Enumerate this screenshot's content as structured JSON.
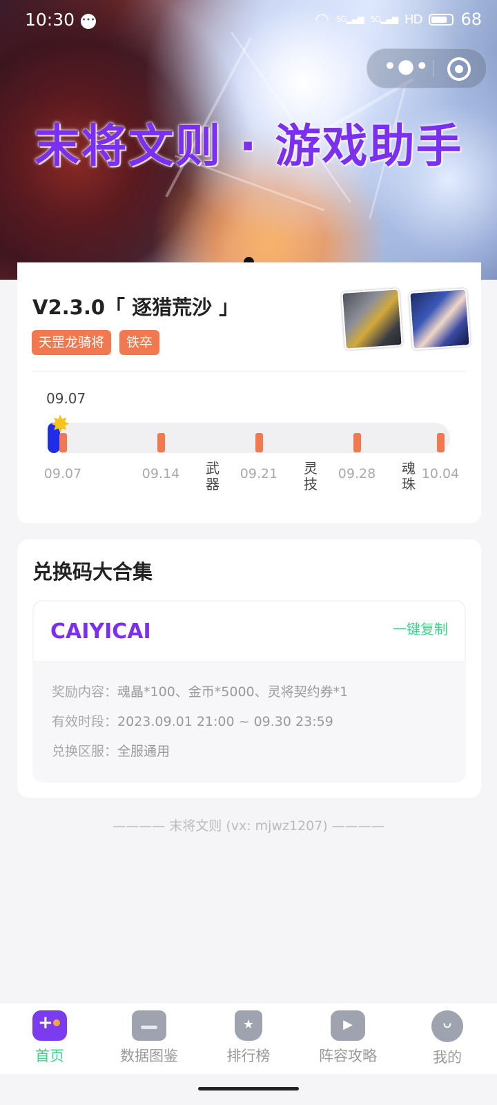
{
  "status_bar": {
    "time": "10:30",
    "signal1": "5G",
    "signal2": "5G",
    "hd": "HD",
    "battery": "68"
  },
  "banner": {
    "title": "末将文则 · 游戏助手"
  },
  "version": {
    "title": "V2.3.0「 逐猎荒沙 」",
    "tags": [
      "天罡龙骑将",
      "铁卒"
    ],
    "current_date": "09.07",
    "progress": 0.0,
    "timeline_labels": [
      "09.07",
      "09.14",
      "09.21",
      "09.28",
      "10.04"
    ],
    "events": [
      "武器",
      "灵技",
      "魂珠"
    ]
  },
  "redeem": {
    "section_title": "兑换码大合集",
    "code": "CAIYICAI",
    "copy_label": "一键复制",
    "reward_key": "奖励内容：",
    "reward_value": "魂晶*100、金币*5000、灵将契约券*1",
    "valid_key": "有效时段：",
    "valid_value": "2023.09.01 21:00 ~ 09.30 23:59",
    "server_key": "兑换区服：",
    "server_value": "全服通用"
  },
  "footer": {
    "note": "———— 末将文则 (vx: mjwz1207) ————"
  },
  "tabbar": {
    "tabs": [
      {
        "label": "首页",
        "icon": "gamepad-icon",
        "active": true
      },
      {
        "label": "数据图鉴",
        "icon": "folder-icon",
        "active": false
      },
      {
        "label": "排行榜",
        "icon": "trophy-icon",
        "active": false
      },
      {
        "label": "阵容攻略",
        "icon": "tv-icon",
        "active": false
      },
      {
        "label": "我的",
        "icon": "profile-icon",
        "active": false
      }
    ]
  },
  "colors": {
    "accent_purple": "#7b30f0",
    "accent_green": "#3dd68c",
    "tag_orange": "#f2784f",
    "progress_blue": "#1e2ee6"
  }
}
